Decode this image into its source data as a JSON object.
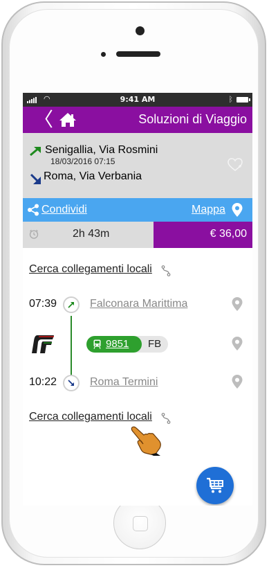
{
  "status_bar": {
    "time": "9:41 AM"
  },
  "app_bar": {
    "title": "Soluzioni di Viaggio"
  },
  "trip": {
    "from": "Senigallia, Via Rosmini",
    "date_time": "18/03/2016 07:15",
    "to": "Roma, Via Verbania"
  },
  "actions": {
    "share": "Condividi",
    "map": "Mappa"
  },
  "summary": {
    "duration": "2h 43m",
    "price": "€ 36,00"
  },
  "local_link_top": "Cerca collegamenti locali",
  "departure": {
    "time": "07:39",
    "station": "Falconara Marittima"
  },
  "train": {
    "number": "9851",
    "category": "FB"
  },
  "arrival": {
    "time": "10:22",
    "station": "Roma Termini"
  },
  "local_link_bottom": "Cerca collegamenti locali",
  "colors": {
    "purple": "#8a0fa0",
    "blue": "#4aa6f0",
    "green": "#2ea02e",
    "cart": "#1f6fd6"
  }
}
